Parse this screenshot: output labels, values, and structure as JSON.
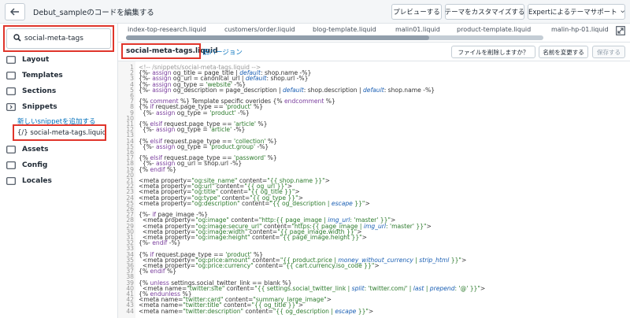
{
  "topbar": {
    "title": "Debut_sampleのコードを編集する",
    "buttons": [
      "プレビューする",
      "テーマをカスタマイズする",
      "Expertによるテーマサポート"
    ],
    "back_icon": "arrow-left-icon"
  },
  "sidebar": {
    "search_value": "social-meta-tags",
    "folders": [
      "Layout",
      "Templates",
      "Sections",
      "Snippets",
      "Assets",
      "Config",
      "Locales"
    ],
    "add_snippet_link": "新しいsnippetを追加する",
    "snippet_file": "social-meta-tags.liquid",
    "snippet_file_prefix": "{/}"
  },
  "tabs": [
    "index-top-research.liquid",
    "customers/order.liquid",
    "blog-template.liquid",
    "malin01.liquid",
    "product-template.liquid",
    "malin-hp-01.liquid"
  ],
  "editor": {
    "filename": "social-meta-tags.liquid",
    "old_version": "旧バージョン",
    "delete_btn": "ファイルを削除しますか？",
    "rename_btn": "名前を変更する",
    "save_btn": "保存する"
  },
  "code_lines": [
    "<!-- /snippets/social-meta-tags.liquid -->",
    "{%- assign og_title = page_title | default: shop.name -%}",
    "{%- assign og_url = canonical_url | default: shop.url -%}",
    "{%- assign og_type = 'website' -%}",
    "{%- assign og_description = page_description | default: shop.description | default: shop.name -%}",
    "",
    "{% comment %} Template specific overides {% endcomment %}",
    "{% if request.page_type == 'product' %}",
    "  {%- assign og_type = 'product' -%}",
    "",
    "{% elsif request.page_type == 'article' %}",
    "  {%- assign og_type = 'article' -%}",
    "",
    "{% elsif request.page_type == 'collection' %}",
    "  {%- assign og_type = 'product.group' -%}",
    "",
    "{% elsif request.page_type == 'password' %}",
    "  {%- assign og_url = shop.url -%}",
    "{% endif %}",
    "",
    "<meta property=\"og:site_name\" content=\"{{ shop.name }}\">",
    "<meta property=\"og:url\" content=\"{{ og_url }}\">",
    "<meta property=\"og:title\" content=\"{{ og_title }}\">",
    "<meta property=\"og:type\" content=\"{{ og_type }}\">",
    "<meta property=\"og:description\" content=\"{{ og_description | escape }}\">",
    "",
    "{%- if page_image -%}",
    "  <meta property=\"og:image\" content=\"http:{{ page_image | img_url: 'master' }}\">",
    "  <meta property=\"og:image:secure_url\" content=\"https:{{ page_image | img_url: 'master' }}\">",
    "  <meta property=\"og:image:width\" content=\"{{ page_image.width }}\">",
    "  <meta property=\"og:image:height\" content=\"{{ page_image.height }}\">",
    "{%- endif -%}",
    "",
    "{% if request.page_type == 'product' %}",
    "  <meta property=\"og:price:amount\" content=\"{{ product.price | money_without_currency | strip_html }}\">",
    "  <meta property=\"og:price:currency\" content=\"{{ cart.currency.iso_code }}\">",
    "{% endif %}",
    "",
    "{% unless settings.social_twitter_link == blank %}",
    "  <meta name=\"twitter:site\" content=\"{{ settings.social_twitter_link | split: 'twitter.com/' | last | prepend: '@' }}\">",
    "{% endunless %}",
    "<meta name=\"twitter:card\" content=\"summary_large_image\">",
    "<meta name=\"twitter:title\" content=\"{{ og_title }}\">",
    "<meta name=\"twitter:description\" content=\"{{ og_description | escape }}\">"
  ]
}
